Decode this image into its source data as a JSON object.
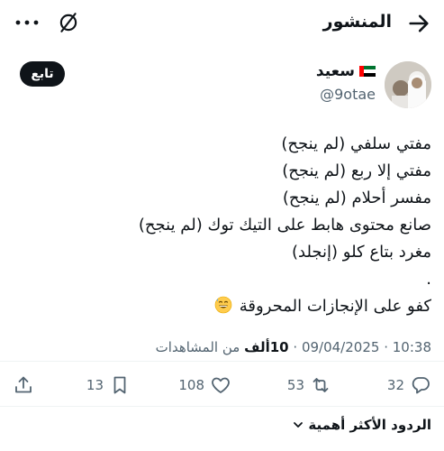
{
  "header": {
    "title": "المنشور",
    "back_icon": "arrow-right-icon",
    "grok_icon": "grok-icon",
    "more_icon": "more-horizontal-icon"
  },
  "author": {
    "name": "سعيد",
    "handle": "@9otae",
    "flag_icon": "uae-flag-icon",
    "follow_label": "تابع"
  },
  "tweet": {
    "lines": [
      "مفتي سلفي (لم ينجح)",
      "مفتي إلا ربع (لم ينجح)",
      "مفسر أحلام (لم ينجح)",
      "صانع محتوى هابط على التيك توك (لم ينجح)",
      "مغرد بتاع كلو (إنجلد)",
      ".",
      "كفو على الإنجازات المحروقة"
    ],
    "emoji": "grinning-sweat-emoji"
  },
  "meta": {
    "date": "09/04/2025",
    "time": "10:38",
    "separator": "·",
    "views_count": "10ألف",
    "views_label": "من المشاهدات"
  },
  "actions": {
    "replies": "32",
    "retweets": "53",
    "likes": "108",
    "bookmarks": "13"
  },
  "replies_sort": {
    "label": "الردود الأكثر أهمية"
  },
  "colors": {
    "text_primary": "#0f1419",
    "text_secondary": "#536471",
    "divider": "#eff3f4",
    "follow_bg": "#0f1419"
  }
}
